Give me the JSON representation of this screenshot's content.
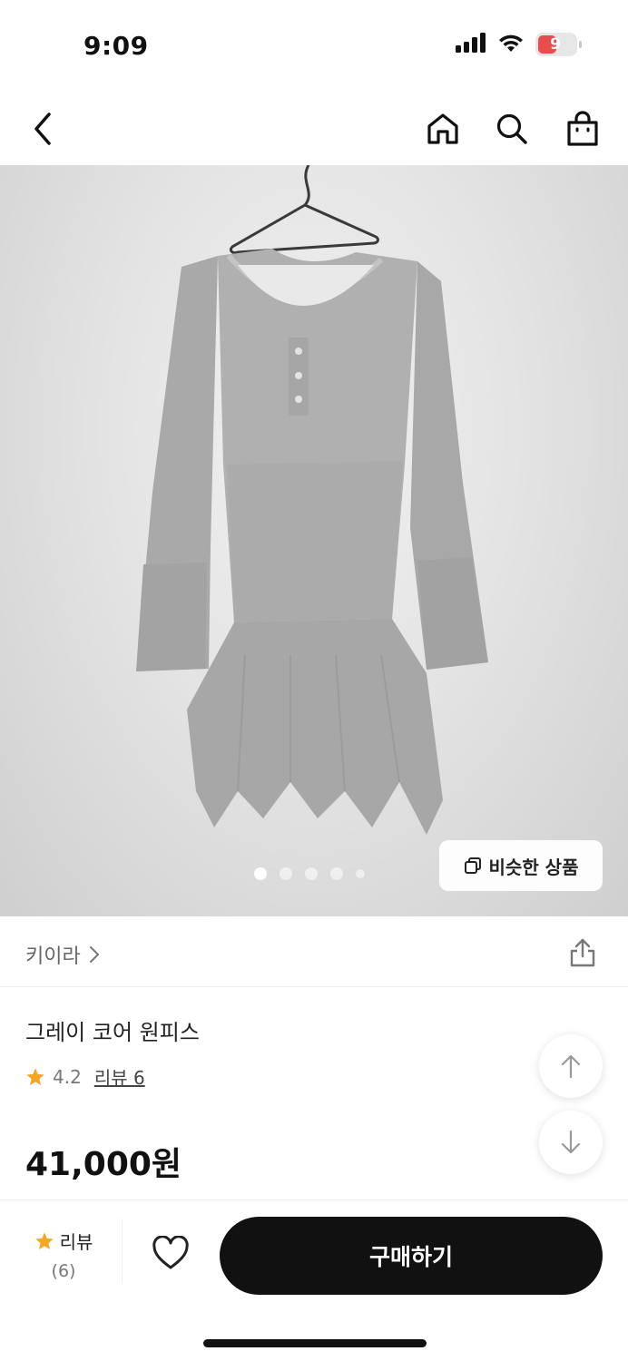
{
  "status_bar": {
    "time": "9:09",
    "battery_level": "9",
    "icons": [
      "signal-icon",
      "wifi-icon",
      "battery-icon"
    ]
  },
  "nav": {
    "icons": [
      "back-arrow-icon",
      "home-icon",
      "search-icon",
      "shopping-bag-icon"
    ]
  },
  "gallery": {
    "dot_count": 5,
    "active_index": 0,
    "similar_button_label": "비슷한 상품"
  },
  "brand": {
    "name": "키이라"
  },
  "product": {
    "title": "그레이 코어 원피스",
    "rating": "4.2",
    "review_label": "리뷰 6",
    "price": "41,000원"
  },
  "bottom_bar": {
    "review_label": "리뷰",
    "review_count": "(6)",
    "buy_label": "구매하기"
  },
  "colors": {
    "star": "#F5A623",
    "primary_button": "#111111",
    "battery_low": "#EA4C4C"
  }
}
